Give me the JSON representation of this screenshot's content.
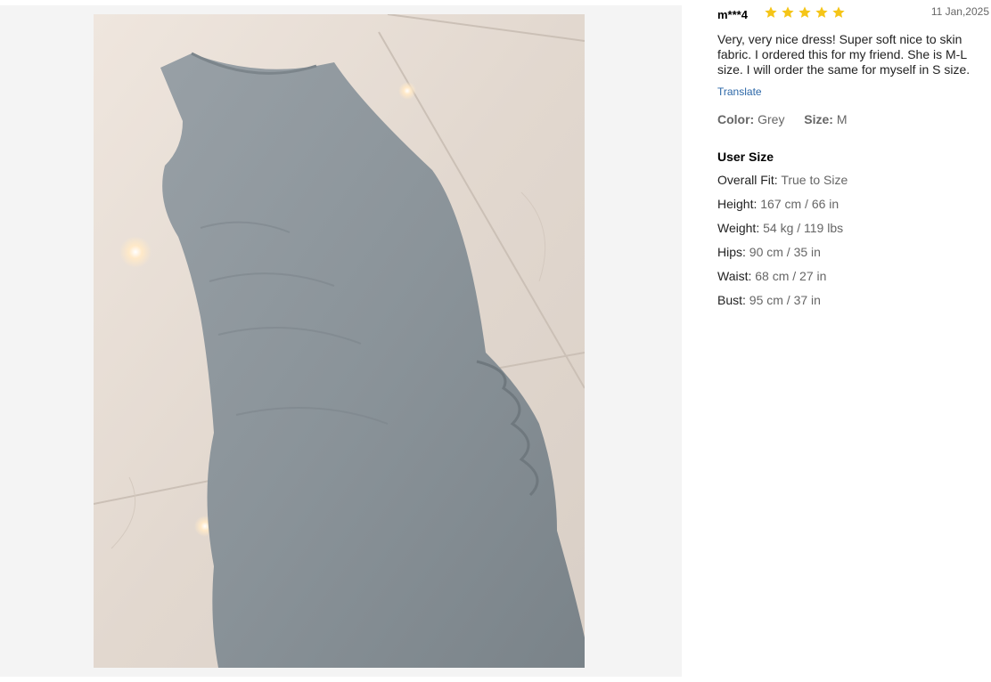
{
  "review": {
    "user": "m***4",
    "rating": 5,
    "date": "11 Jan,2025",
    "text": "Very, very nice dress! Super soft nice to skin fabric. I ordered this for my friend. She is M-L size. I will order the same for myself in S size.",
    "translate_label": "Translate",
    "attributes": {
      "color_key": "Color:",
      "color_value": "Grey",
      "size_key": "Size:",
      "size_value": "M"
    }
  },
  "user_size": {
    "title": "User Size",
    "rows": [
      {
        "label": "Overall Fit:",
        "value": "True to Size"
      },
      {
        "label": "Height:",
        "value": "167 cm / 66 in"
      },
      {
        "label": "Weight:",
        "value": "54 kg / 119 lbs"
      },
      {
        "label": "Hips:",
        "value": "90 cm / 35 in"
      },
      {
        "label": "Waist:",
        "value": "68 cm / 27 in"
      },
      {
        "label": "Bust:",
        "value": "95 cm / 37 in"
      }
    ]
  },
  "colors": {
    "star": "#f5c518",
    "link": "#2d68a8",
    "dress": "#8d969c",
    "floor": "#e6dcd4"
  }
}
